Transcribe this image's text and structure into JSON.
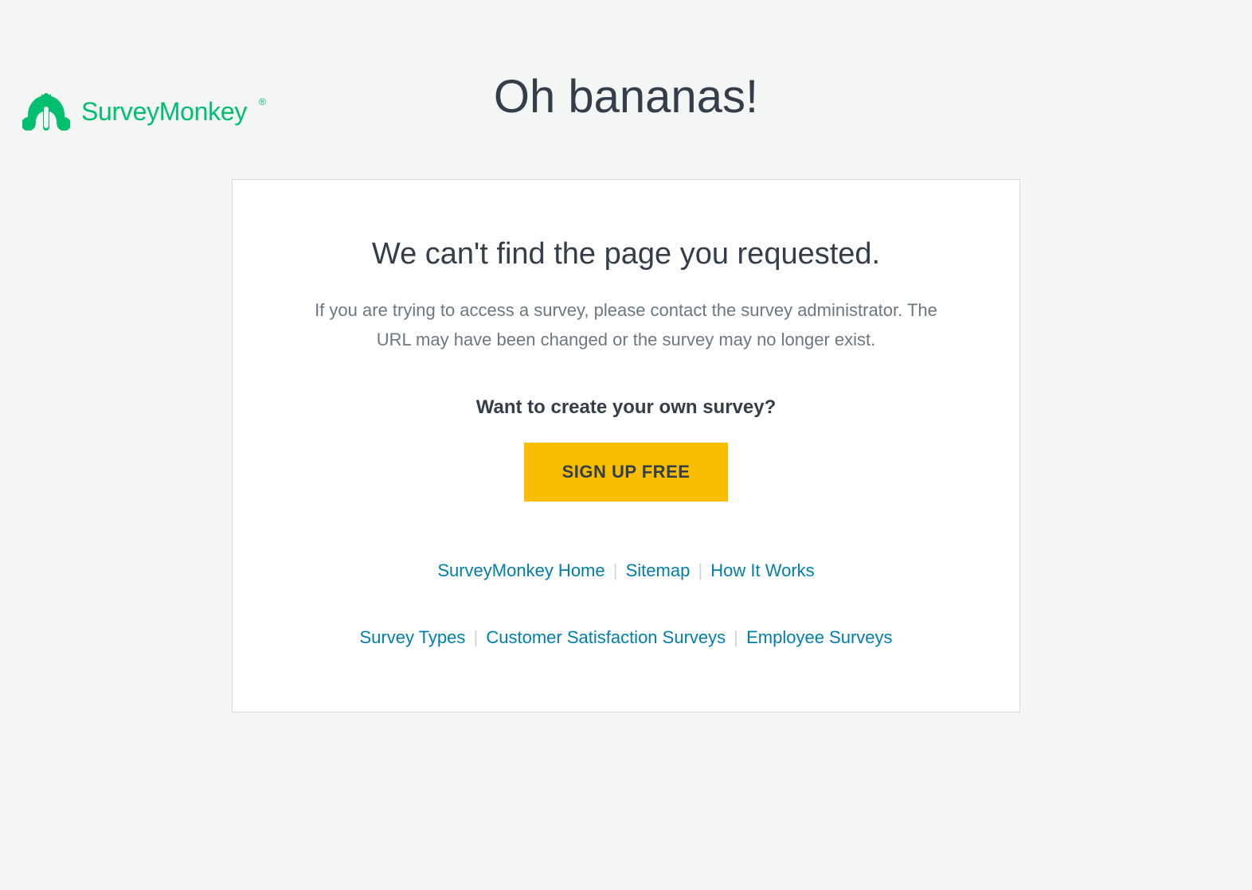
{
  "brand": {
    "name": "SurveyMonkey",
    "color": "#00BF6F"
  },
  "page": {
    "title": "Oh bananas!"
  },
  "card": {
    "heading": "We can't find the page you requested.",
    "description": "If you are trying to access a survey, please contact the survey administrator. The URL may have been changed or the survey may no longer exist.",
    "prompt": "Want to create your own survey?",
    "cta": "SIGN UP FREE"
  },
  "links": {
    "row1": {
      "home": "SurveyMonkey Home",
      "sitemap": "Sitemap",
      "how": "How It Works"
    },
    "row2": {
      "types": "Survey Types",
      "csat": "Customer Satisfaction Surveys",
      "employee": "Employee Surveys"
    }
  }
}
